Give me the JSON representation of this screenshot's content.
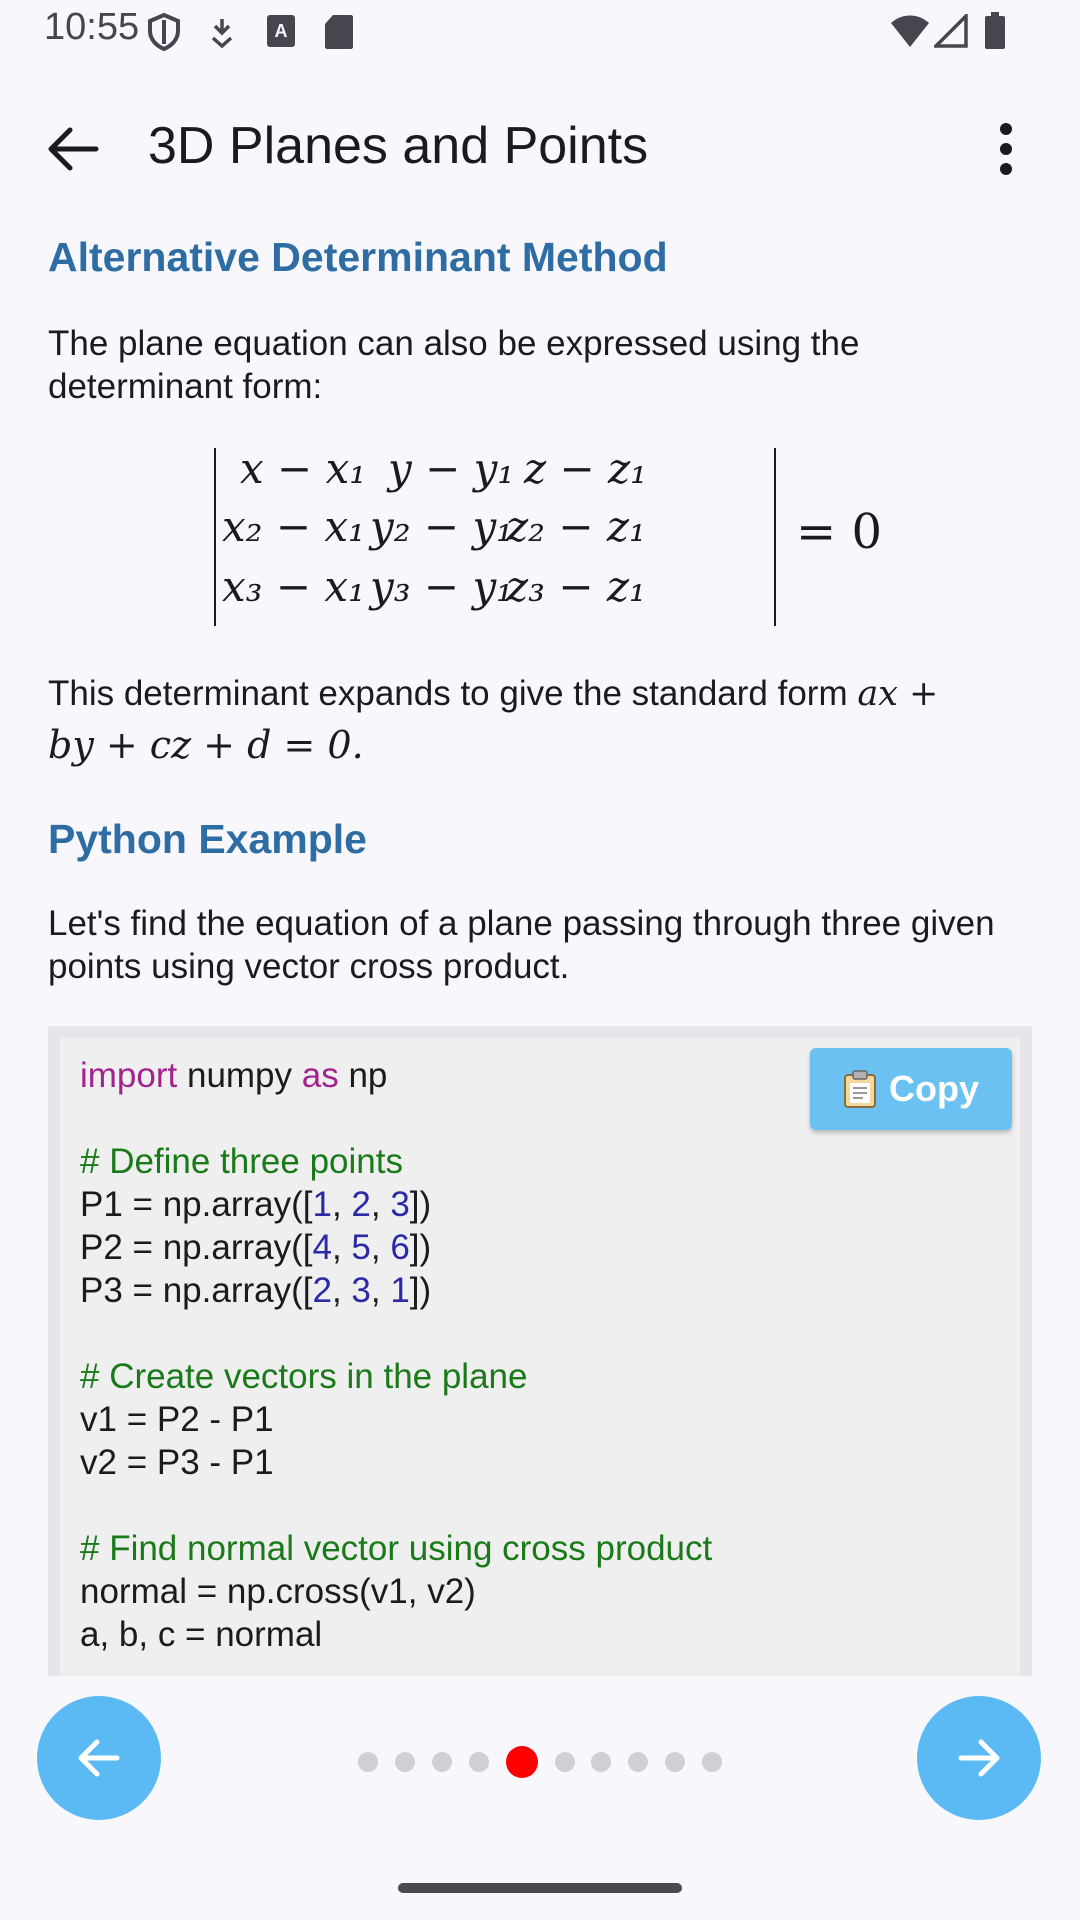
{
  "status": {
    "time": "10:55"
  },
  "app_bar": {
    "title": "3D Planes and Points"
  },
  "section1": {
    "heading": "Alternative Determinant Method",
    "intro": "The plane equation can also be expressed using the determinant form:",
    "expand_text": "This determinant expands to give the standard form ",
    "expand_math_a": "ax +",
    "expand_math_b": "by + cz + d = 0."
  },
  "determinant": {
    "rows": [
      [
        "x − x₁",
        "y − y₁",
        "z − z₁"
      ],
      [
        "x₂ − x₁",
        "y₂ − y₁",
        "z₂ − z₁"
      ],
      [
        "x₃ − x₁",
        "y₃ − y₁",
        "z₃ − z₁"
      ]
    ],
    "equals": "= 0"
  },
  "section2": {
    "heading": "Python Example",
    "intro": "Let's find the equation of a plane passing through three given points using vector cross product."
  },
  "code": {
    "copy_label": "Copy",
    "lines": [
      "import numpy as np",
      "",
      "# Define three points",
      "P1 = np.array([1, 2, 3])",
      "P2 = np.array([4, 5, 6])",
      "P3 = np.array([2, 3, 1])",
      "",
      "# Create vectors in the plane",
      "v1 = P2 - P1",
      "v2 = P3 - P1",
      "",
      "# Find normal vector using cross product",
      "normal = np.cross(v1, v2)",
      "a, b, c = normal"
    ]
  },
  "pager": {
    "total": 10,
    "active_index": 4
  },
  "colors": {
    "accent": "#2e6da4",
    "fab": "#5bbaf3",
    "active_dot": "#ff0000"
  },
  "icons": {
    "back": "back-arrow-icon",
    "more": "more-vert-icon",
    "prev": "arrow-left-icon",
    "next": "arrow-right-icon",
    "copy": "clipboard-icon"
  }
}
